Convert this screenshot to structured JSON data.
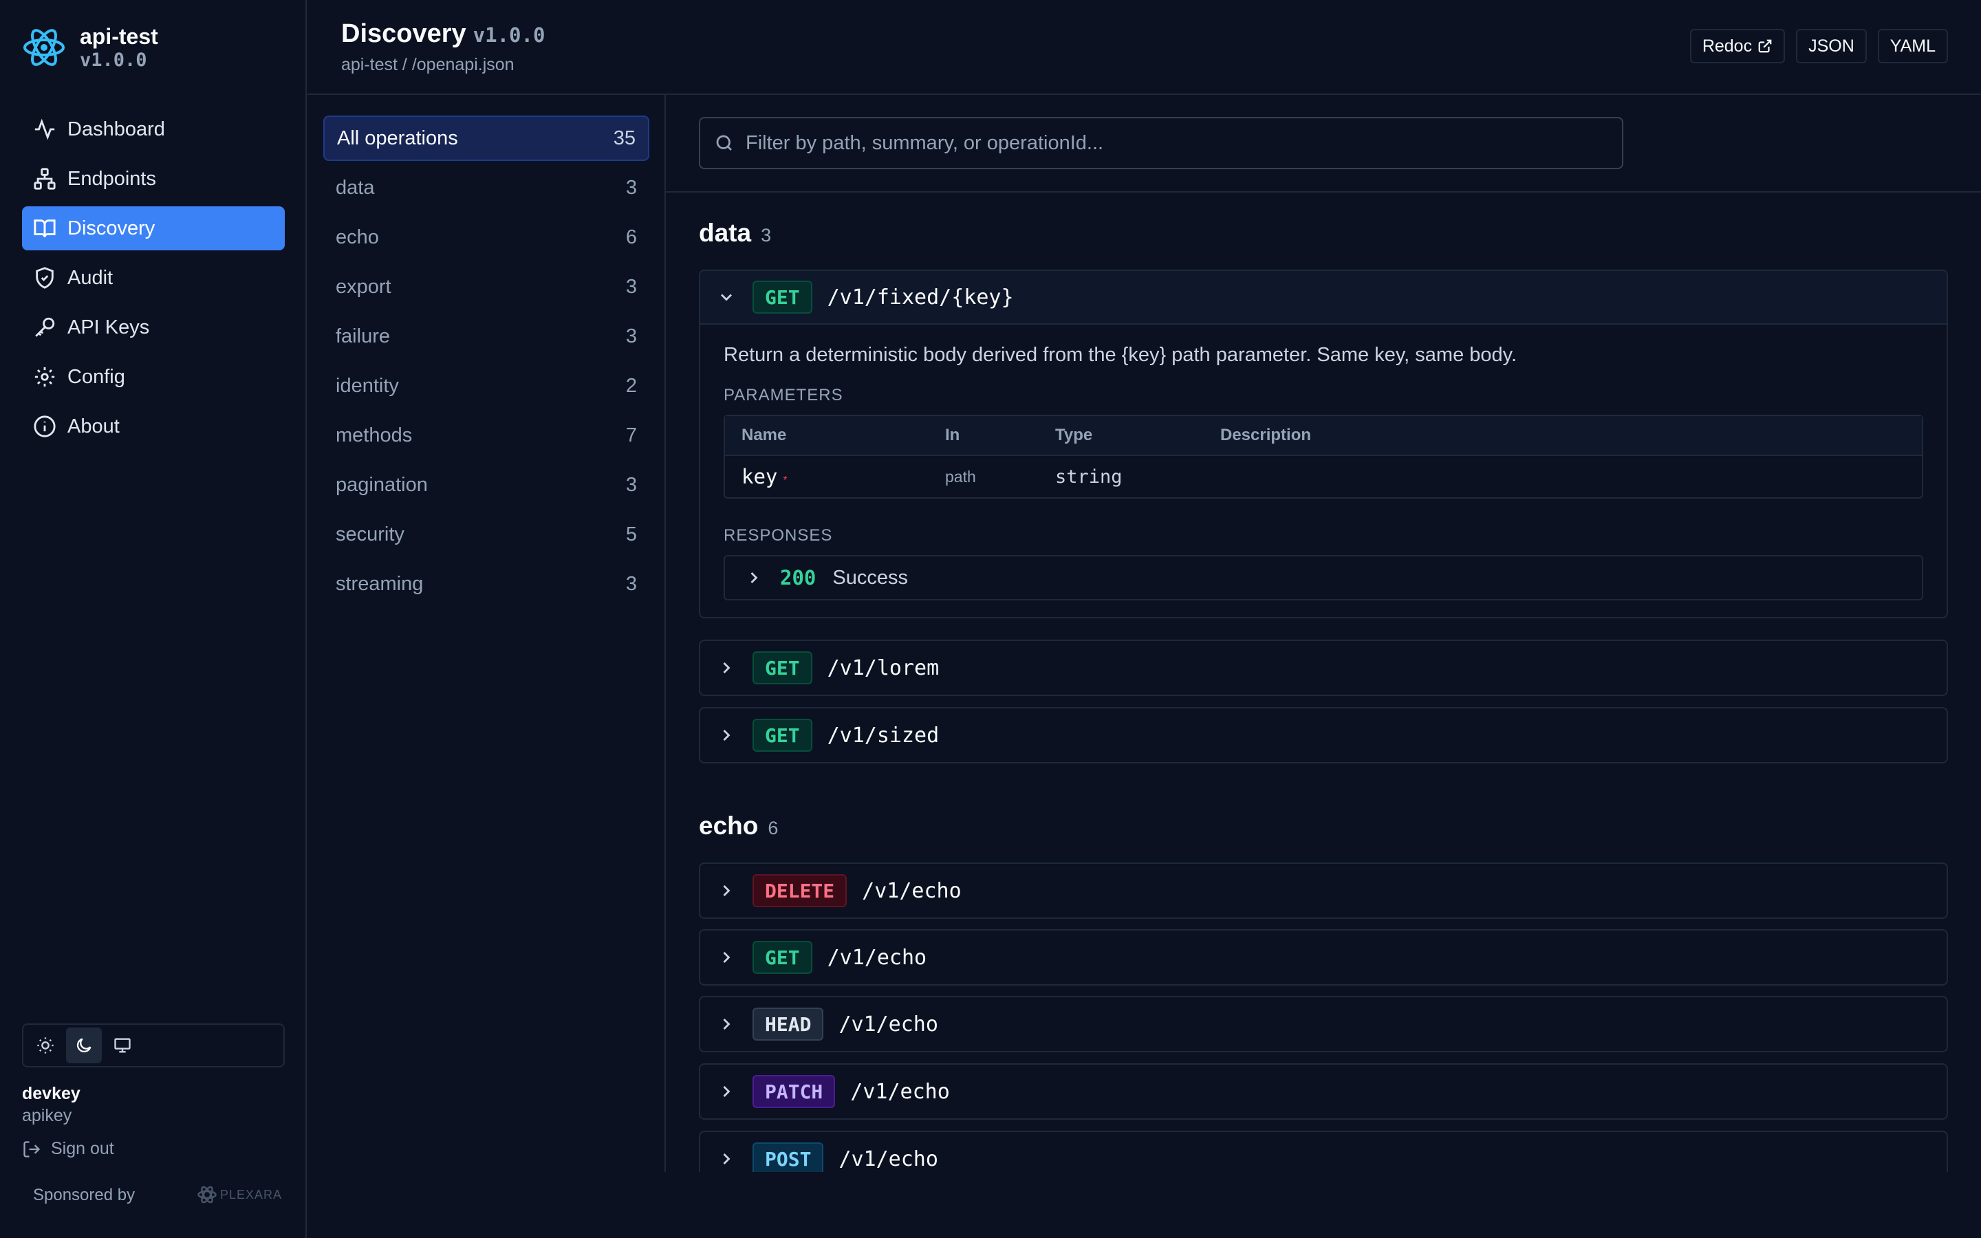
{
  "app": {
    "name": "api-test",
    "version": "v1.0.0"
  },
  "nav": [
    {
      "label": "Dashboard",
      "icon": "activity-icon",
      "active": false
    },
    {
      "label": "Endpoints",
      "icon": "network-icon",
      "active": false
    },
    {
      "label": "Discovery",
      "icon": "book-open-icon",
      "active": true
    },
    {
      "label": "Audit",
      "icon": "shield-check-icon",
      "active": false
    },
    {
      "label": "API Keys",
      "icon": "key-icon",
      "active": false
    },
    {
      "label": "Config",
      "icon": "gear-icon",
      "active": false
    },
    {
      "label": "About",
      "icon": "info-icon",
      "active": false
    }
  ],
  "theme": {
    "selected": "dark",
    "options": [
      "light",
      "dark",
      "system"
    ]
  },
  "user": {
    "name": "devkey",
    "role": "apikey",
    "signout": "Sign out"
  },
  "sponsor": {
    "label": "Sponsored by",
    "logo_text": "PLEXARA"
  },
  "header": {
    "title": "Discovery",
    "version": "v1.0.0",
    "breadcrumb": "api-test / /openapi.json",
    "buttons": {
      "redoc": "Redoc",
      "json": "JSON",
      "yaml": "YAML"
    }
  },
  "tags": [
    {
      "label": "All operations",
      "count": "35",
      "active": true
    },
    {
      "label": "data",
      "count": "3"
    },
    {
      "label": "echo",
      "count": "6"
    },
    {
      "label": "export",
      "count": "3"
    },
    {
      "label": "failure",
      "count": "3"
    },
    {
      "label": "identity",
      "count": "2"
    },
    {
      "label": "methods",
      "count": "7"
    },
    {
      "label": "pagination",
      "count": "3"
    },
    {
      "label": "security",
      "count": "5"
    },
    {
      "label": "streaming",
      "count": "3"
    }
  ],
  "filter": {
    "placeholder": "Filter by path, summary, or operationId..."
  },
  "sections": {
    "data": {
      "title": "data",
      "count": "3",
      "expanded": {
        "method": "GET",
        "path": "/v1/fixed/{key}",
        "description": "Return a deterministic body derived from the {key} path parameter. Same key, same body.",
        "params_title": "PARAMETERS",
        "param_headers": [
          "Name",
          "In",
          "Type",
          "Description"
        ],
        "param": {
          "name": "key",
          "required": "*",
          "in": "path",
          "type": "string",
          "description": ""
        },
        "responses_title": "RESPONSES",
        "response": {
          "code": "200",
          "text": "Success"
        }
      },
      "ops": [
        {
          "method": "GET",
          "path": "/v1/lorem"
        },
        {
          "method": "GET",
          "path": "/v1/sized"
        }
      ]
    },
    "echo": {
      "title": "echo",
      "count": "6",
      "ops": [
        {
          "method": "DELETE",
          "path": "/v1/echo"
        },
        {
          "method": "GET",
          "path": "/v1/echo"
        },
        {
          "method": "HEAD",
          "path": "/v1/echo"
        },
        {
          "method": "PATCH",
          "path": "/v1/echo"
        },
        {
          "method": "POST",
          "path": "/v1/echo"
        }
      ]
    }
  },
  "colors": {
    "accent": "#3b82f6",
    "get": "#34d399",
    "delete": "#fb7185",
    "patch": "#c4b5fd",
    "post": "#7dd3fc"
  }
}
